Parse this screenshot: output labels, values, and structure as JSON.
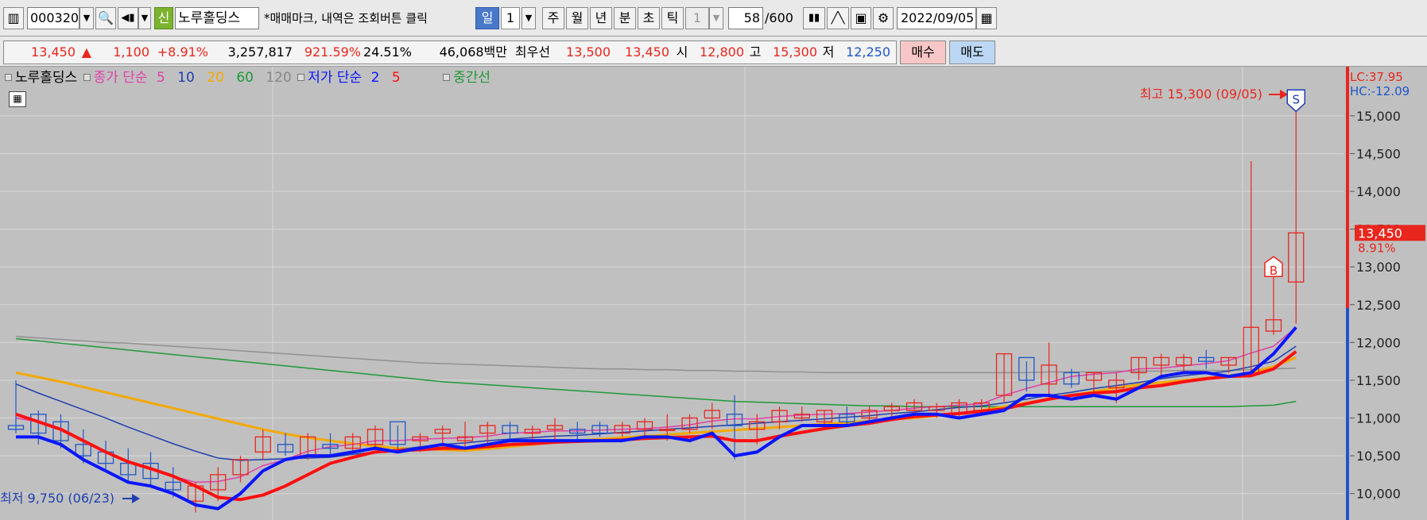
{
  "toolbar": {
    "code": "000320",
    "chart_type": "신",
    "name": "노루홀딩스",
    "notice": "*매매마크, 내역은 조회버튼 클릭",
    "periods": [
      "일",
      "1",
      "주",
      "월",
      "년",
      "분",
      "초",
      "틱",
      "1"
    ],
    "count": "58",
    "count_total": "/600",
    "date": "2022/09/05"
  },
  "quote": {
    "price": "13,450",
    "arrow": "▲",
    "change": "1,100",
    "change_rate": "+8.91%",
    "volume": "3,257,817",
    "vol_ratio": "921.59%",
    "turnover": "24.51%",
    "amount": "46,068백만",
    "best_label": "최우선",
    "ask": "13,500",
    "bid": "13,450",
    "open_label": "시",
    "open": "12,800",
    "high_label": "고",
    "high": "15,300",
    "low_label": "저",
    "low": "12,250",
    "buy": "매수",
    "sell": "매도"
  },
  "legend": {
    "name": "노루홀딩스",
    "close_ma": "종가 단순",
    "ma5": "5",
    "ma10": "10",
    "ma20": "20",
    "ma60": "60",
    "ma120": "120",
    "low_ma": "저가 단순",
    "lma2": "2",
    "lma5": "5",
    "mid": "중간선"
  },
  "colors": {
    "up": "#e8261e",
    "down": "#1f56c9",
    "ma5": "#e040a8",
    "ma10": "#1f3fb0",
    "ma20": "#f3a900",
    "ma60": "#1f9a3a",
    "ma120": "#909090",
    "low2": "#0a16ff",
    "low5": "#ff1010"
  },
  "chart_data": {
    "type": "candlestick",
    "ylim": [
      9650,
      15650
    ],
    "yticks": [
      "15,000",
      "14,500",
      "14,000",
      "13,500",
      "13,000",
      "12,500",
      "12,000",
      "11,500",
      "11,000",
      "10,500",
      "10,000"
    ],
    "annotations": {
      "high": "최고 15,300 (09/05)",
      "low": "최저 9,750 (06/23)",
      "lc": "LC:37.95",
      "hc": "HC:-12.09",
      "cur_price": "13,450",
      "cur_rate": "8.91%",
      "buy_mark": "B",
      "sell_mark": "S"
    },
    "ohlc": [
      [
        10900,
        11500,
        10800,
        10850
      ],
      [
        11050,
        11100,
        10650,
        10800
      ],
      [
        10950,
        11050,
        10600,
        10700
      ],
      [
        10650,
        10850,
        10400,
        10500
      ],
      [
        10550,
        10700,
        10300,
        10400
      ],
      [
        10400,
        10600,
        10150,
        10250
      ],
      [
        10400,
        10550,
        10100,
        10200
      ],
      [
        10150,
        10350,
        9950,
        10050
      ],
      [
        9900,
        10150,
        9750,
        10100
      ],
      [
        10050,
        10350,
        9900,
        10250
      ],
      [
        10250,
        10500,
        10150,
        10450
      ],
      [
        10550,
        10850,
        10450,
        10750
      ],
      [
        10650,
        10800,
        10500,
        10550
      ],
      [
        10500,
        10800,
        10450,
        10750
      ],
      [
        10650,
        10800,
        10500,
        10600
      ],
      [
        10600,
        10800,
        10550,
        10750
      ],
      [
        10650,
        10900,
        10600,
        10850
      ],
      [
        10950,
        10900,
        10550,
        10650
      ],
      [
        10700,
        10800,
        10550,
        10750
      ],
      [
        10800,
        10900,
        10600,
        10850
      ],
      [
        10700,
        10950,
        10600,
        10750
      ],
      [
        10800,
        10950,
        10600,
        10900
      ],
      [
        10900,
        10950,
        10700,
        10800
      ],
      [
        10800,
        10900,
        10650,
        10850
      ],
      [
        10850,
        11000,
        10700,
        10900
      ],
      [
        10850,
        10950,
        10700,
        10800
      ],
      [
        10900,
        10950,
        10750,
        10800
      ],
      [
        10800,
        10950,
        10750,
        10900
      ],
      [
        10850,
        11000,
        10750,
        10950
      ],
      [
        10850,
        11050,
        10700,
        10850
      ],
      [
        10850,
        11050,
        10800,
        11000
      ],
      [
        11000,
        11200,
        10850,
        11100
      ],
      [
        11050,
        11300,
        10450,
        10900
      ],
      [
        10850,
        11050,
        10650,
        10950
      ],
      [
        10950,
        11150,
        10850,
        11100
      ],
      [
        11000,
        11150,
        10950,
        11050
      ],
      [
        10950,
        11100,
        10850,
        11100
      ],
      [
        11050,
        11150,
        10900,
        10950
      ],
      [
        11000,
        11150,
        10950,
        11100
      ],
      [
        11100,
        11200,
        11000,
        11150
      ],
      [
        11100,
        11250,
        11000,
        11200
      ],
      [
        11100,
        11200,
        11000,
        11150
      ],
      [
        11050,
        11250,
        11000,
        11200
      ],
      [
        11100,
        11250,
        11050,
        11200
      ],
      [
        11300,
        11850,
        11200,
        11850
      ],
      [
        11800,
        11750,
        11350,
        11500
      ],
      [
        11450,
        12000,
        11250,
        11700
      ],
      [
        11600,
        11650,
        11400,
        11450
      ],
      [
        11500,
        11600,
        11300,
        11600
      ],
      [
        11400,
        11600,
        11200,
        11500
      ],
      [
        11600,
        11800,
        11500,
        11800
      ],
      [
        11700,
        11850,
        11550,
        11800
      ],
      [
        11700,
        11850,
        11600,
        11800
      ],
      [
        11800,
        11900,
        11650,
        11750
      ],
      [
        11700,
        11800,
        11600,
        11800
      ],
      [
        11600,
        14400,
        11600,
        12200
      ],
      [
        12150,
        13050,
        12100,
        12300
      ],
      [
        12800,
        15300,
        12250,
        13450
      ]
    ],
    "ma": {
      "ma5": [
        11000,
        10950,
        10850,
        10700,
        10550,
        10420,
        10330,
        10230,
        10150,
        10160,
        10220,
        10370,
        10450,
        10560,
        10620,
        10650,
        10700,
        10700,
        10720,
        10730,
        10740,
        10760,
        10800,
        10810,
        10830,
        10830,
        10840,
        10850,
        10860,
        10880,
        10910,
        10960,
        10990,
        10990,
        11020,
        11040,
        11050,
        11060,
        11080,
        11100,
        11130,
        11150,
        11170,
        11190,
        11300,
        11390,
        11470,
        11550,
        11580,
        11600,
        11650,
        11660,
        11690,
        11720,
        11760,
        11860,
        11950,
        12200
      ],
      "ma10": [
        11450,
        11330,
        11220,
        11110,
        11000,
        10880,
        10770,
        10660,
        10560,
        10470,
        10440,
        10450,
        10460,
        10470,
        10480,
        10520,
        10550,
        10580,
        10620,
        10650,
        10670,
        10700,
        10720,
        10740,
        10760,
        10770,
        10790,
        10810,
        10830,
        10850,
        10870,
        10890,
        10910,
        10930,
        10950,
        10970,
        10990,
        11010,
        11030,
        11060,
        11080,
        11110,
        11140,
        11160,
        11200,
        11250,
        11300,
        11340,
        11390,
        11430,
        11470,
        11520,
        11560,
        11590,
        11620,
        11680,
        11750,
        11950
      ],
      "ma20": [
        11600,
        11540,
        11480,
        11410,
        11340,
        11270,
        11200,
        11130,
        11060,
        10990,
        10920,
        10850,
        10790,
        10740,
        10700,
        10660,
        10630,
        10600,
        10590,
        10580,
        10570,
        10590,
        10620,
        10650,
        10680,
        10700,
        10720,
        10740,
        10760,
        10780,
        10800,
        10820,
        10840,
        10860,
        10880,
        10900,
        10920,
        10940,
        10960,
        10980,
        11000,
        11030,
        11060,
        11100,
        11150,
        11200,
        11250,
        11300,
        11350,
        11400,
        11440,
        11470,
        11500,
        11530,
        11560,
        11600,
        11680,
        11800
      ],
      "ma60": [
        12050,
        12020,
        11990,
        11960,
        11930,
        11900,
        11870,
        11840,
        11810,
        11780,
        11750,
        11720,
        11690,
        11660,
        11630,
        11600,
        11570,
        11540,
        11510,
        11480,
        11460,
        11440,
        11420,
        11400,
        11380,
        11360,
        11340,
        11320,
        11300,
        11280,
        11260,
        11240,
        11220,
        11210,
        11200,
        11190,
        11180,
        11170,
        11160,
        11160,
        11150,
        11150,
        11150,
        11150,
        11150,
        11150,
        11150,
        11150,
        11150,
        11150,
        11150,
        11150,
        11150,
        11150,
        11150,
        11160,
        11170,
        11220
      ],
      "ma120": [
        12080,
        12060,
        12040,
        12020,
        12000,
        11990,
        11970,
        11950,
        11930,
        11910,
        11890,
        11870,
        11850,
        11830,
        11810,
        11790,
        11770,
        11750,
        11730,
        11720,
        11710,
        11700,
        11690,
        11680,
        11670,
        11660,
        11650,
        11650,
        11640,
        11640,
        11630,
        11630,
        11620,
        11620,
        11610,
        11610,
        11600,
        11600,
        11600,
        11600,
        11600,
        11600,
        11600,
        11600,
        11600,
        11600,
        11610,
        11610,
        11610,
        11620,
        11620,
        11620,
        11630,
        11630,
        11630,
        11640,
        11650,
        11660
      ],
      "low2": [
        10750,
        10750,
        10650,
        10450,
        10300,
        10150,
        10100,
        10000,
        9850,
        9800,
        10000,
        10300,
        10450,
        10500,
        10500,
        10550,
        10600,
        10550,
        10600,
        10650,
        10600,
        10650,
        10700,
        10700,
        10700,
        10700,
        10700,
        10700,
        10750,
        10750,
        10700,
        10800,
        10500,
        10550,
        10750,
        10900,
        10900,
        10900,
        10950,
        11000,
        11050,
        11050,
        11000,
        11050,
        11100,
        11300,
        11300,
        11250,
        11300,
        11250,
        11400,
        11550,
        11600,
        11600,
        11550,
        11600,
        11850,
        12200
      ],
      "low5": [
        11050,
        10950,
        10850,
        10700,
        10550,
        10420,
        10330,
        10230,
        10100,
        9950,
        9920,
        9980,
        10100,
        10250,
        10400,
        10480,
        10550,
        10570,
        10580,
        10600,
        10600,
        10620,
        10650,
        10660,
        10680,
        10690,
        10700,
        10710,
        10730,
        10740,
        10750,
        10760,
        10700,
        10700,
        10760,
        10810,
        10860,
        10900,
        10930,
        10980,
        11020,
        11040,
        11060,
        11090,
        11120,
        11190,
        11250,
        11300,
        11330,
        11350,
        11400,
        11430,
        11480,
        11520,
        11550,
        11560,
        11650,
        11880
      ]
    }
  }
}
